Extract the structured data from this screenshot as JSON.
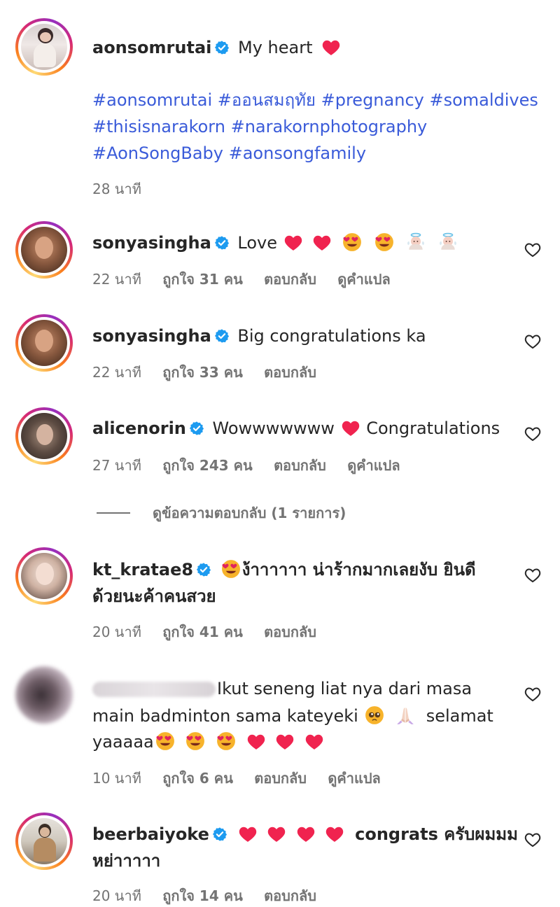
{
  "post": {
    "username": "aonsomrutai",
    "caption": "My heart",
    "hashtag_lines": [
      "#aonsomrutai #ออนสมฤทัย #pregnancy #somaldives",
      "#thisisnarakorn #narakornphotography",
      "#AonSongBaby #aonsongfamily"
    ],
    "time": "28 นาที"
  },
  "comments": [
    {
      "username": "sonyasingha",
      "text": "Love",
      "emojis": [
        "red-heart",
        "red-heart",
        "heart-eyes",
        "heart-eyes",
        "baby-angel",
        "baby-angel"
      ],
      "time": "22 นาที",
      "likes": "ถูกใจ 31 คน",
      "reply": "ตอบกลับ",
      "translate": "ดูคำแปล"
    },
    {
      "username": "sonyasingha",
      "text": "Big congratulations ka",
      "time": "22 นาที",
      "likes": "ถูกใจ 33 คน",
      "reply": "ตอบกลับ"
    },
    {
      "username": "alicenorin",
      "text_before": "Wowwwwwww",
      "text_after": "Congratulations",
      "time": "27 นาที",
      "likes": "ถูกใจ 243 คน",
      "reply": "ตอบกลับ",
      "translate": "ดูคำแปล",
      "view_replies": "ดูข้อความตอบกลับ (1 รายการ)"
    },
    {
      "username": "kt_kratae8",
      "line1": "ง้าาาาาา น่าร้ากมากเลยงับ ยินดี",
      "line2": "ด้วยนะค้าคนสวย",
      "time": "20 นาที",
      "likes": "ถูกใจ 41 คน",
      "reply": "ตอบกลับ"
    },
    {
      "line1": "Ikut seneng liat nya dari masa",
      "line2_before": "main badminton sama kateyeki",
      "line2_after": "selamat",
      "line3": "yaaaaa",
      "time": "10 นาที",
      "likes": "ถูกใจ 6 คน",
      "reply": "ตอบกลับ",
      "translate": "ดูคำแปล"
    },
    {
      "username": "beerbaiyoke",
      "line1_after": "congrats ครับผมมม",
      "line2": "หย่าาาาา",
      "time": "20 นาที",
      "likes": "ถูกใจ 14 คน",
      "reply": "ตอบกลับ"
    }
  ],
  "colors": {
    "verified": "#1d9bf0",
    "hashtag": "#3a5bd9",
    "heart": "#f01d4d",
    "meta": "#737373"
  },
  "icons": {
    "like": "heart-outline-icon",
    "verified": "verified-badge-icon"
  }
}
